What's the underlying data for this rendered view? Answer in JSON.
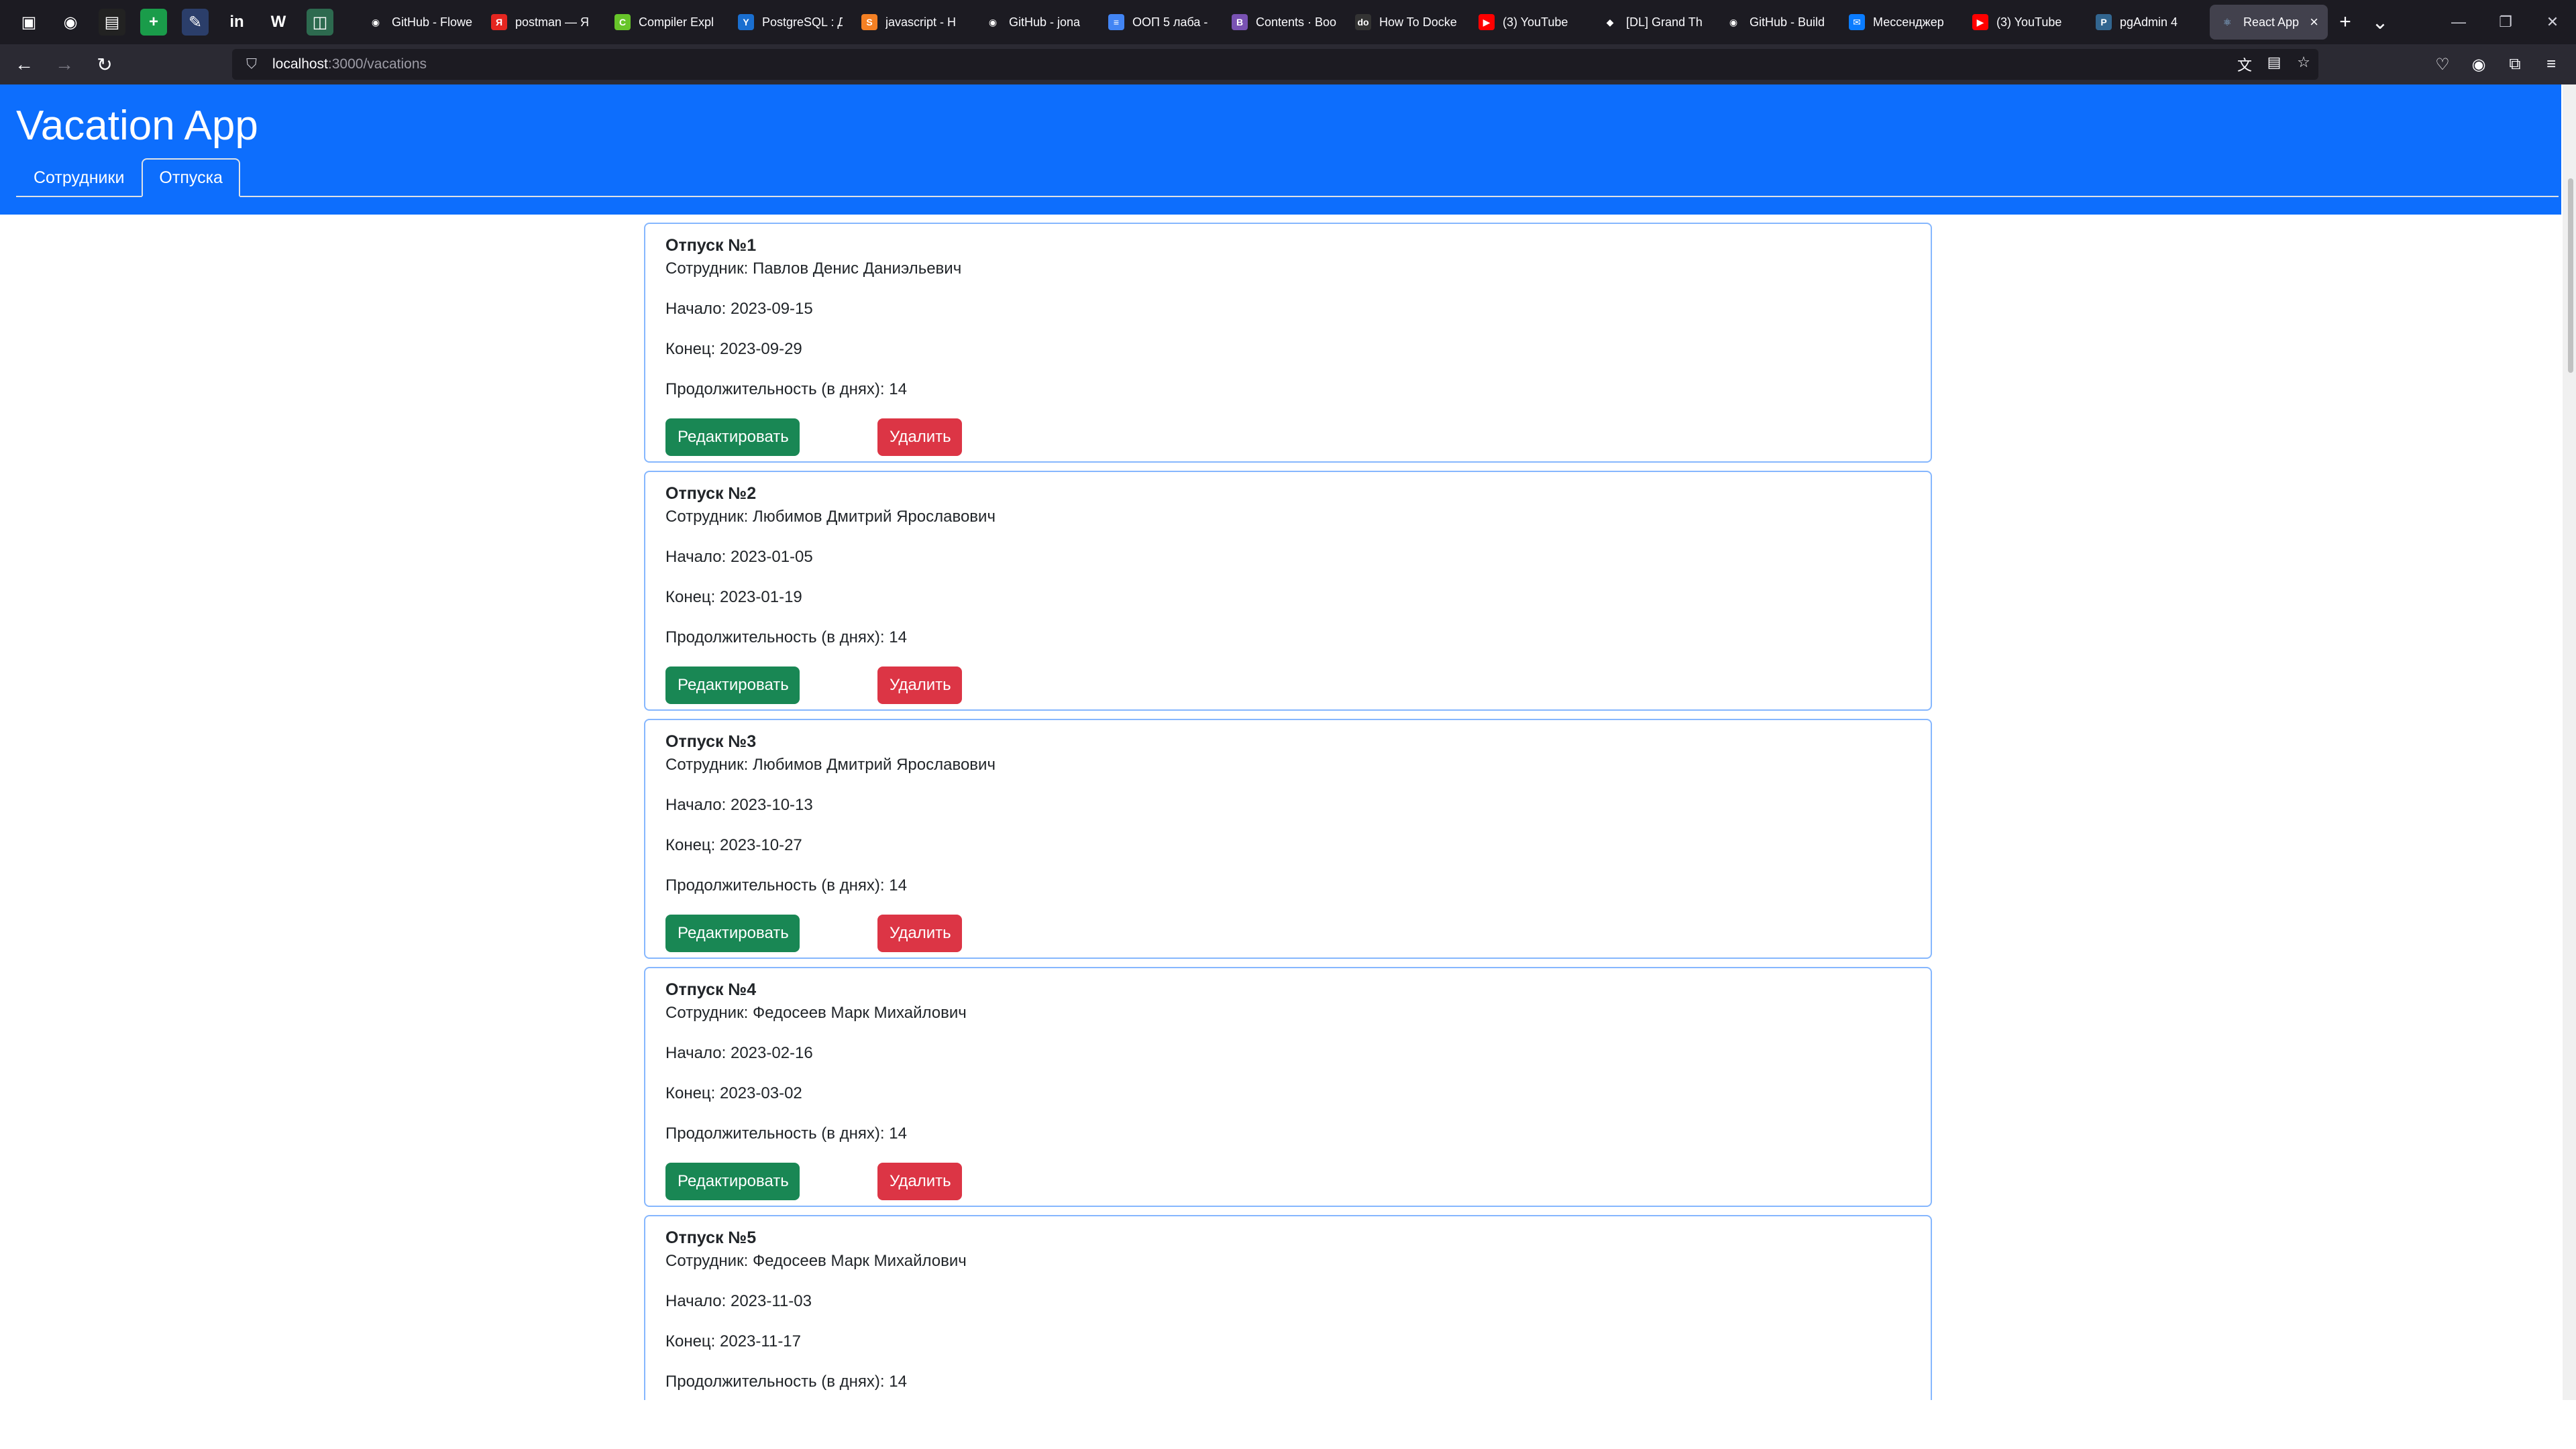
{
  "browser": {
    "pinned": [
      {
        "icon": "tab-manager-icon",
        "char": "▣",
        "bg": "transparent"
      },
      {
        "icon": "github-icon",
        "char": "◉",
        "bg": "transparent"
      },
      {
        "icon": "sheets-icon",
        "char": "▤",
        "bg": "#222"
      },
      {
        "icon": "add-icon",
        "char": "+",
        "bg": "#1a9c4a"
      },
      {
        "icon": "edit-icon",
        "char": "✎",
        "bg": "#2b3e6a"
      },
      {
        "icon": "linkedin-icon",
        "char": "in",
        "bg": "transparent"
      },
      {
        "icon": "w-icon",
        "char": "W",
        "bg": "transparent"
      },
      {
        "icon": "chart-icon",
        "char": "◫",
        "bg": "#2d6a4f"
      }
    ],
    "tabs": [
      {
        "title": "GitHub - Flowe",
        "icon": "github-icon",
        "char": "◉",
        "bg": "transparent"
      },
      {
        "title": "postman — Я",
        "icon": "yandex-icon",
        "char": "Я",
        "bg": "#e52620"
      },
      {
        "title": "Compiler Expl",
        "icon": "compiler-icon",
        "char": "C",
        "bg": "#67c52a"
      },
      {
        "title": "PostgreSQL : Д",
        "icon": "postgres-icon",
        "char": "Y",
        "bg": "#1a6fd0"
      },
      {
        "title": "javascript - Н",
        "icon": "stackoverflow-icon",
        "char": "S",
        "bg": "#f48024"
      },
      {
        "title": "GitHub - jona",
        "icon": "github-icon",
        "char": "◉",
        "bg": "transparent"
      },
      {
        "title": "ООП 5 лаба -",
        "icon": "docs-icon",
        "char": "≡",
        "bg": "#4285f4"
      },
      {
        "title": "Contents · Boo",
        "icon": "bootstrap-icon",
        "char": "B",
        "bg": "#7952b3"
      },
      {
        "title": "How To Docke",
        "icon": "do-icon",
        "char": "do",
        "bg": "#333"
      },
      {
        "title": "(3) YouTube",
        "icon": "youtube-icon",
        "char": "▶",
        "bg": "#ff0000"
      },
      {
        "title": "[DL] Grand Th",
        "icon": "rockstar-icon",
        "char": "◆",
        "bg": "transparent"
      },
      {
        "title": "GitHub - Build",
        "icon": "github-icon",
        "char": "◉",
        "bg": "transparent"
      },
      {
        "title": "Мессенджер",
        "icon": "messenger-icon",
        "char": "✉",
        "bg": "#0a7cff"
      },
      {
        "title": "(3) YouTube",
        "icon": "youtube-icon",
        "char": "▶",
        "bg": "#ff0000"
      },
      {
        "title": "pgAdmin 4",
        "icon": "pgadmin-icon",
        "char": "P",
        "bg": "#326690"
      }
    ],
    "active_tab": {
      "title": "React App",
      "icon": "react-icon",
      "char": "⚛"
    },
    "url_host": "localhost",
    "url_path": ":3000/vacations"
  },
  "app": {
    "title": "Vacation App",
    "nav": [
      {
        "label": "Сотрудники",
        "active": false
      },
      {
        "label": "Отпуска",
        "active": true
      }
    ],
    "labels": {
      "employee": "Сотрудник: ",
      "start": "Начало: ",
      "end": "Конец: ",
      "duration": "Продолжительность (в днях): ",
      "edit": "Редактировать",
      "delete": "Удалить"
    },
    "vacations": [
      {
        "title": "Отпуск №1",
        "employee": "Павлов Денис Даниэльевич",
        "start": "2023-09-15",
        "end": "2023-09-29",
        "duration": "14"
      },
      {
        "title": "Отпуск №2",
        "employee": "Любимов Дмитрий Ярославович",
        "start": "2023-01-05",
        "end": "2023-01-19",
        "duration": "14"
      },
      {
        "title": "Отпуск №3",
        "employee": "Любимов Дмитрий Ярославович",
        "start": "2023-10-13",
        "end": "2023-10-27",
        "duration": "14"
      },
      {
        "title": "Отпуск №4",
        "employee": "Федосеев Марк Михайлович",
        "start": "2023-02-16",
        "end": "2023-03-02",
        "duration": "14"
      },
      {
        "title": "Отпуск №5",
        "employee": "Федосеев Марк Михайлович",
        "start": "2023-11-03",
        "end": "2023-11-17",
        "duration": "14"
      }
    ]
  },
  "colors": {
    "header": "#0d6efd",
    "edit_button": "#198754",
    "delete_button": "#dc3545",
    "card_border": "#86b7fe"
  }
}
